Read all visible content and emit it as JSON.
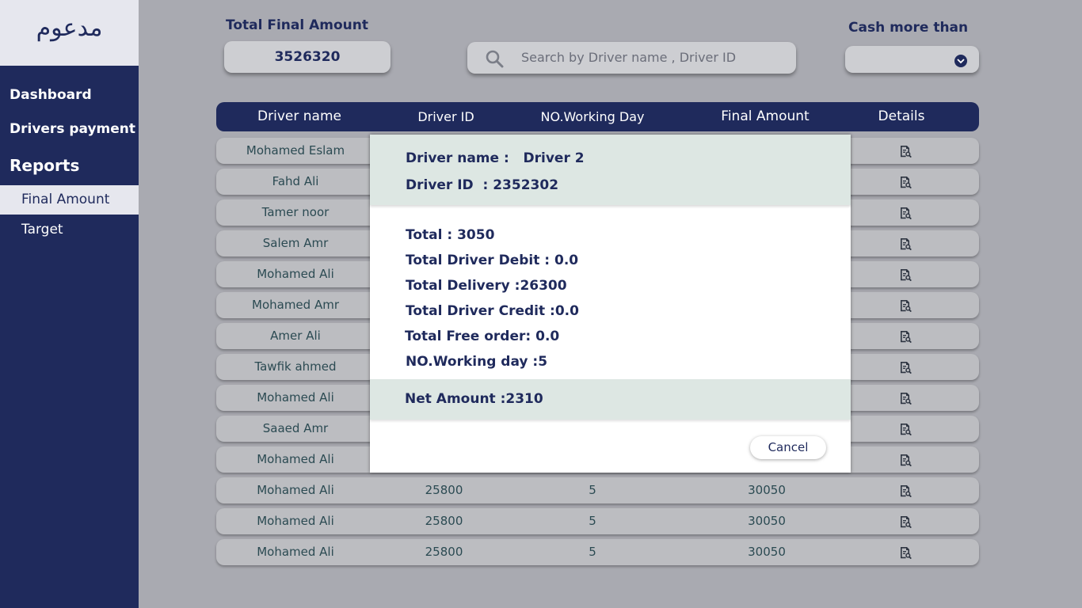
{
  "sidebar": {
    "logo": "مدعوم",
    "dashboard": "Dashboard",
    "drivers_payment": "Drivers payment",
    "reports": "Reports",
    "final_amount": "Final Amount",
    "target": "Target"
  },
  "header": {
    "total_label": "Total Final Amount",
    "total_value": "3526320",
    "search_placeholder": "Search by Driver name , Driver ID",
    "cash_label": "Cash more than",
    "cash_value": ""
  },
  "table": {
    "columns": [
      "Driver name",
      "Driver ID",
      "NO.Working Day",
      "Final Amount",
      "Details"
    ],
    "rows": [
      {
        "name": "Mohamed Eslam",
        "id": "",
        "days": "",
        "amount": ""
      },
      {
        "name": "Fahd Ali",
        "id": "",
        "days": "",
        "amount": ""
      },
      {
        "name": "Tamer noor",
        "id": "",
        "days": "",
        "amount": ""
      },
      {
        "name": "Salem Amr",
        "id": "",
        "days": "",
        "amount": ""
      },
      {
        "name": "Mohamed Ali",
        "id": "",
        "days": "",
        "amount": ""
      },
      {
        "name": "Mohamed Amr",
        "id": "",
        "days": "",
        "amount": ""
      },
      {
        "name": "Amer Ali",
        "id": "",
        "days": "",
        "amount": ""
      },
      {
        "name": "Tawfik ahmed",
        "id": "",
        "days": "",
        "amount": ""
      },
      {
        "name": "Mohamed Ali",
        "id": "",
        "days": "",
        "amount": ""
      },
      {
        "name": "Saaed Amr",
        "id": "",
        "days": "",
        "amount": ""
      },
      {
        "name": "Mohamed Ali",
        "id": "",
        "days": "",
        "amount": ""
      },
      {
        "name": "Mohamed Ali",
        "id": "25800",
        "days": "5",
        "amount": "30050"
      },
      {
        "name": "Mohamed Ali",
        "id": "25800",
        "days": "5",
        "amount": "30050"
      },
      {
        "name": "Mohamed Ali",
        "id": "25800",
        "days": "5",
        "amount": "30050"
      }
    ]
  },
  "modal": {
    "driver_name": "Driver name :   Driver 2",
    "driver_id": "Driver ID  : 2352302",
    "total": "Total : 3050",
    "total_debit": "Total Driver Debit : 0.0",
    "total_delivery": "Total Delivery :26300",
    "total_credit": "Total Driver Credit :0.0",
    "free_order": "Total Free order: 0.0",
    "working_day": "NO.Working day :5",
    "net_amount": "Net Amount :2310",
    "cancel": "Cancel"
  },
  "colors": {
    "navy": "#1f2a5c",
    "overlay_bg": "#a9aab1",
    "modal_band": "#dde7e3",
    "row_text": "#2b4a52"
  }
}
